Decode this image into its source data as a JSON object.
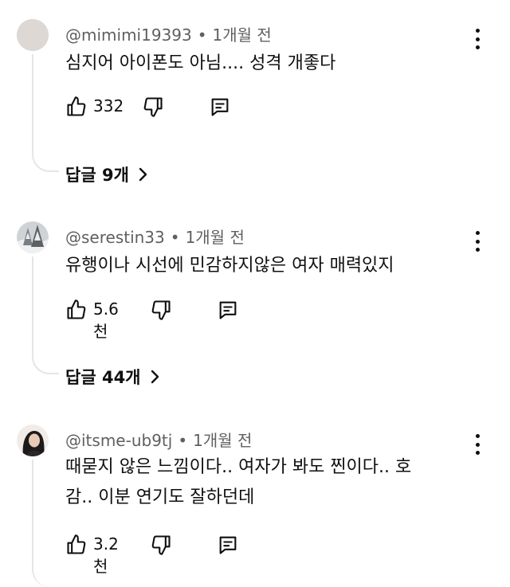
{
  "comments": [
    {
      "author": "@mimimi19393",
      "time": "1개월 전",
      "text_lines": [
        "심지어 아이폰도 아님.... 성격 개좋다"
      ],
      "likes": "332",
      "replies_label": "답글 9개",
      "avatar_icon": "avatar-blank-icon"
    },
    {
      "author": "@serestin33",
      "time": "1개월 전",
      "text_lines": [
        "유행이나 시선에 민감하지않은 여자 매력있지"
      ],
      "likes": "5.6천",
      "replies_label": "답글 44개",
      "avatar_icon": "avatar-snowy-tree-icon"
    },
    {
      "author": "@itsme-ub9tj",
      "time": "1개월 전",
      "text_lines": [
        "때묻지 않은 느낌이다.. 여자가 봐도 찐이다.. 호",
        "감.. 이분 연기도 잘하던데"
      ],
      "likes": "3.2천",
      "avatar_icon": "avatar-person-icon"
    }
  ],
  "icons": {
    "like": "thumbs-up-icon",
    "dislike": "thumbs-down-icon",
    "reply": "reply-icon",
    "more": "more-vertical-icon",
    "chevron": "chevron-right-icon"
  },
  "separator": "•"
}
